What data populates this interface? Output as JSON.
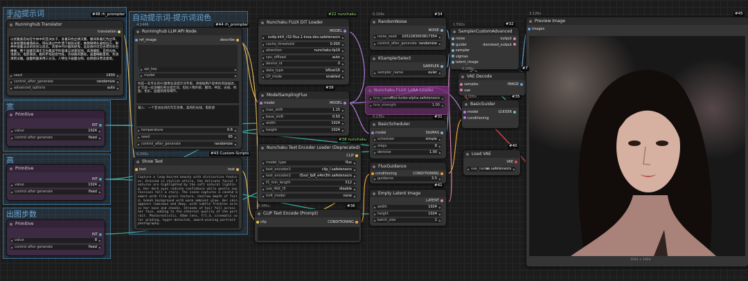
{
  "groups": [
    {
      "title": "手动提示词"
    },
    {
      "title": "自动提示词-提示词润色"
    },
    {
      "title": "宽"
    },
    {
      "title": "高"
    },
    {
      "title": "出图步数"
    }
  ],
  "runninghub_translator": {
    "badge": "#48 rh_prompter",
    "version": "16.2106",
    "title": "Runninghub Translator",
    "out": "translation",
    "text": "以优雅姿态站在竹林中的亚洲女子，身着白色丝绸汉服，腰间系着红色丝带，长发如瀑般垂落肩头，阳光透过竹叶洒下斑驳光影，她微微侧头凝视远方，眼神中透着淡淡的忧伤与思念。背景中竹叶随风摇曳，远处隐约可见古老的亭台楼阁，整个画面充满东方古典美学的意境与诗意氛围。高清摄影，自然光线，浅景深，电影质感。她的手指轻抚竹枝，衣袂随风飘动，画面细腻柔和，色调清新淡雅。画面构图采用三分法，人物位于画面左侧，右侧留白营造意境。",
    "w_seed": "seed",
    "v_seed": "1930",
    "w_cag": "control_after_generate",
    "v_cag": "randomize",
    "w_adv": "advanced_options",
    "v_adv": "auto"
  },
  "llm_api": {
    "badge": "#44 rh_prompter",
    "version": "4.1446",
    "title": "Runninghub LLM API Node",
    "in1": "ref_image",
    "out": "describe",
    "wa": "api_key",
    "wb": "model",
    "text1": "你是一名专业的AI图像生成提示词专家。请根据用户提供的简短描述，扩写成一段详细的英文提示词，包括人物外貌、服饰、神态、光线、构图、色彩、画面风格等细节。",
    "text2": "输入: 一个亚洲女孩的写实肖像，柔和的光线，电影感",
    "w_temp": "temperature",
    "v_temp": "0.6",
    "w_seed": "seed",
    "v_seed": "65",
    "w_cag": "control_after_generate",
    "v_cag": "randomize"
  },
  "show_text": {
    "badge": "#43 Custom-Scripts",
    "version": "0.300s",
    "title": "Show Text",
    "in": "text",
    "out": "text",
    "text": "Capture a long-haired beauty with distinctive features. Dressed in stylish attire, the delicate facial features are highlighted by the soft natural lighting. Her dark eyes radiate confidence while gentle expressions tell a story. The scene captures a candid moment with film grain texture, shallow depth of field, bokeh background with warm ambient glow. Her skin appears luminous and dewy, with subtle freckles across her nose and cheeks. Strands of hair fall across her face, adding to the ethereal quality of the portrait. Photorealistic, 85mm lens, f/1.4, cinematic color grading, hyper-detailed, award-winning portrait photography."
  },
  "primitives": [
    {
      "title": "Primitive",
      "out": "INT",
      "w_val": "value",
      "v_val": "1024",
      "w_cag": "control after generate",
      "v_cag": "fixed"
    },
    {
      "title": "Primitive",
      "out": "INT",
      "w_val": "value",
      "v_val": "1024",
      "w_cag": "control after generate",
      "v_cag": "fixed"
    },
    {
      "title": "Primitive",
      "out": "INT",
      "w_val": "value",
      "v_val": "8",
      "w_cag": "control after generate",
      "v_cag": "fixed"
    }
  ],
  "flux_loader": {
    "badge": "#22 nunchaku",
    "title": "Nunchaku FLUX DiT Loader",
    "out": "MODEL",
    "rows": [
      [
        "",
        "svdq-int4_r32-flux.1-krea-dev.safetensors"
      ],
      [
        "cache_threshold",
        "0.000"
      ],
      [
        "attention",
        "nunchaku-fp16"
      ],
      [
        "cpu_offload",
        "auto"
      ],
      [
        "device_id",
        "0"
      ],
      [
        "data_type",
        "bfloat16"
      ],
      [
        "i2f_mode",
        "enabled"
      ]
    ]
  },
  "model_sampling": {
    "badge": "#39",
    "title": "ModelSamplingFlux",
    "in": "model",
    "out": "MODEL",
    "rows": [
      [
        "max_shift",
        "1.15"
      ],
      [
        "base_shift",
        "0.50"
      ],
      [
        "width",
        "1024"
      ],
      [
        "height",
        "1024"
      ]
    ]
  },
  "text_encoder": {
    "badge": "#38 nunchaku",
    "title": "Nunchaku Text Encoder Loader (Deprecated)",
    "out": "CLIP",
    "rows": [
      [
        "model_type",
        "flux"
      ],
      [
        "text_encoder1",
        "clip_l.safetensors"
      ],
      [
        "text_encoder2",
        "t5xxl_fp8_e4m3fn.safetensors"
      ],
      [
        "t5_min_length",
        "512"
      ],
      [
        "use_4bit_t5",
        "disable"
      ],
      [
        "int4_model",
        "none"
      ]
    ]
  },
  "clip_encode": {
    "badge": "#36",
    "version": "0.345s",
    "title": "CLIP Text Encode (Prompt)",
    "in": "clip",
    "out": "CONDITIONING"
  },
  "random_noise": {
    "badge": "#34",
    "version": "0.104s",
    "title": "RandomNoise",
    "out": "NOISE",
    "rows": [
      [
        "noise_seed",
        "1052283003817354"
      ],
      [
        "control_after_generate",
        "randomize"
      ]
    ]
  },
  "ksampler_select": {
    "badge": "#33",
    "title": "KSamplerSelect",
    "out": "SAMPLER",
    "rows": [
      [
        "sampler_name",
        "euler"
      ]
    ]
  },
  "lora_loader": {
    "badge": "#41",
    "title": "Nunchaku FLUX LoRA Loader",
    "rows": [
      [
        "lora_name",
        "flux-turbo-alpha.safetensors"
      ],
      [
        "lora_strength",
        "1.00"
      ]
    ]
  },
  "basic_scheduler": {
    "badge": "#31",
    "version": "0.235s",
    "title": "BasicScheduler",
    "in": "model",
    "out": "SIGMAS",
    "rows": [
      [
        "scheduler",
        "simple"
      ],
      [
        "steps",
        "8"
      ],
      [
        "denoise",
        "1.00"
      ]
    ]
  },
  "flux_guidance": {
    "badge": "#41",
    "title": "FluxGuidance",
    "in": "conditioning",
    "out": "CONDITIONING",
    "rows": [
      [
        "guidance",
        "3.5"
      ]
    ]
  },
  "empty_latent": {
    "badge": "#42",
    "title": "Empty Latent Image",
    "out": "LATENT",
    "rows": [
      [
        "width",
        "1024"
      ],
      [
        "height",
        "1024"
      ],
      [
        "batch_size",
        "1"
      ]
    ]
  },
  "sampler_custom": {
    "badge": "#32",
    "version": "1.592s",
    "title": "SamplerCustomAdvanced",
    "ins": [
      "noise",
      "guider",
      "sampler",
      "sigmas",
      "latent_image"
    ],
    "outs": [
      "output",
      "denoised_output"
    ]
  },
  "vae_decode": {
    "badge": "#7",
    "version": "0.299s",
    "title": "VAE Decode",
    "ins": [
      "samples",
      "vae"
    ],
    "out": "IMAGE"
  },
  "basic_guider": {
    "badge": "#35",
    "version": "0.000s",
    "title": "BasicGuider",
    "ins": [
      "model",
      "conditioning"
    ],
    "out": "GUIDER"
  },
  "load_vae": {
    "badge": "#40",
    "title": "Load VAE",
    "out": "VAE",
    "rows": [
      [
        "vae_name",
        "ae.safetensors"
      ]
    ]
  },
  "preview": {
    "badge": "#45",
    "version": "3.126s",
    "title": "Preview Image",
    "in": "images",
    "foot": "1024 × 1024"
  }
}
